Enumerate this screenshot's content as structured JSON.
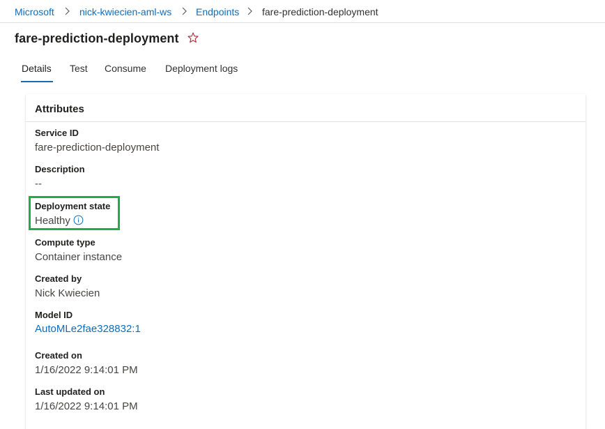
{
  "breadcrumb": {
    "items": [
      "Microsoft",
      "nick-kwiecien-aml-ws",
      "Endpoints",
      "fare-prediction-deployment"
    ]
  },
  "page": {
    "title": "fare-prediction-deployment"
  },
  "tabs": [
    {
      "label": "Details",
      "active": true
    },
    {
      "label": "Test",
      "active": false
    },
    {
      "label": "Consume",
      "active": false
    },
    {
      "label": "Deployment logs",
      "active": false
    }
  ],
  "attributes": {
    "heading": "Attributes",
    "service_id": {
      "label": "Service ID",
      "value": "fare-prediction-deployment"
    },
    "description": {
      "label": "Description",
      "value": "--"
    },
    "deployment_state": {
      "label": "Deployment state",
      "value": "Healthy"
    },
    "compute_type": {
      "label": "Compute type",
      "value": "Container instance"
    },
    "created_by": {
      "label": "Created by",
      "value": "Nick Kwiecien"
    },
    "model_id": {
      "label": "Model ID",
      "value": "AutoMLe2fae328832:1"
    },
    "created_on": {
      "label": "Created on",
      "value": "1/16/2022 9:14:01 PM"
    },
    "last_updated_on": {
      "label": "Last updated on",
      "value": "1/16/2022 9:14:01 PM"
    }
  },
  "colors": {
    "link": "#0f6cbd",
    "favorite_star": "#a4262c",
    "highlight_box": "#22ab4a"
  },
  "icons": [
    "chevron-right-icon",
    "star-outline-icon",
    "info-icon"
  ]
}
